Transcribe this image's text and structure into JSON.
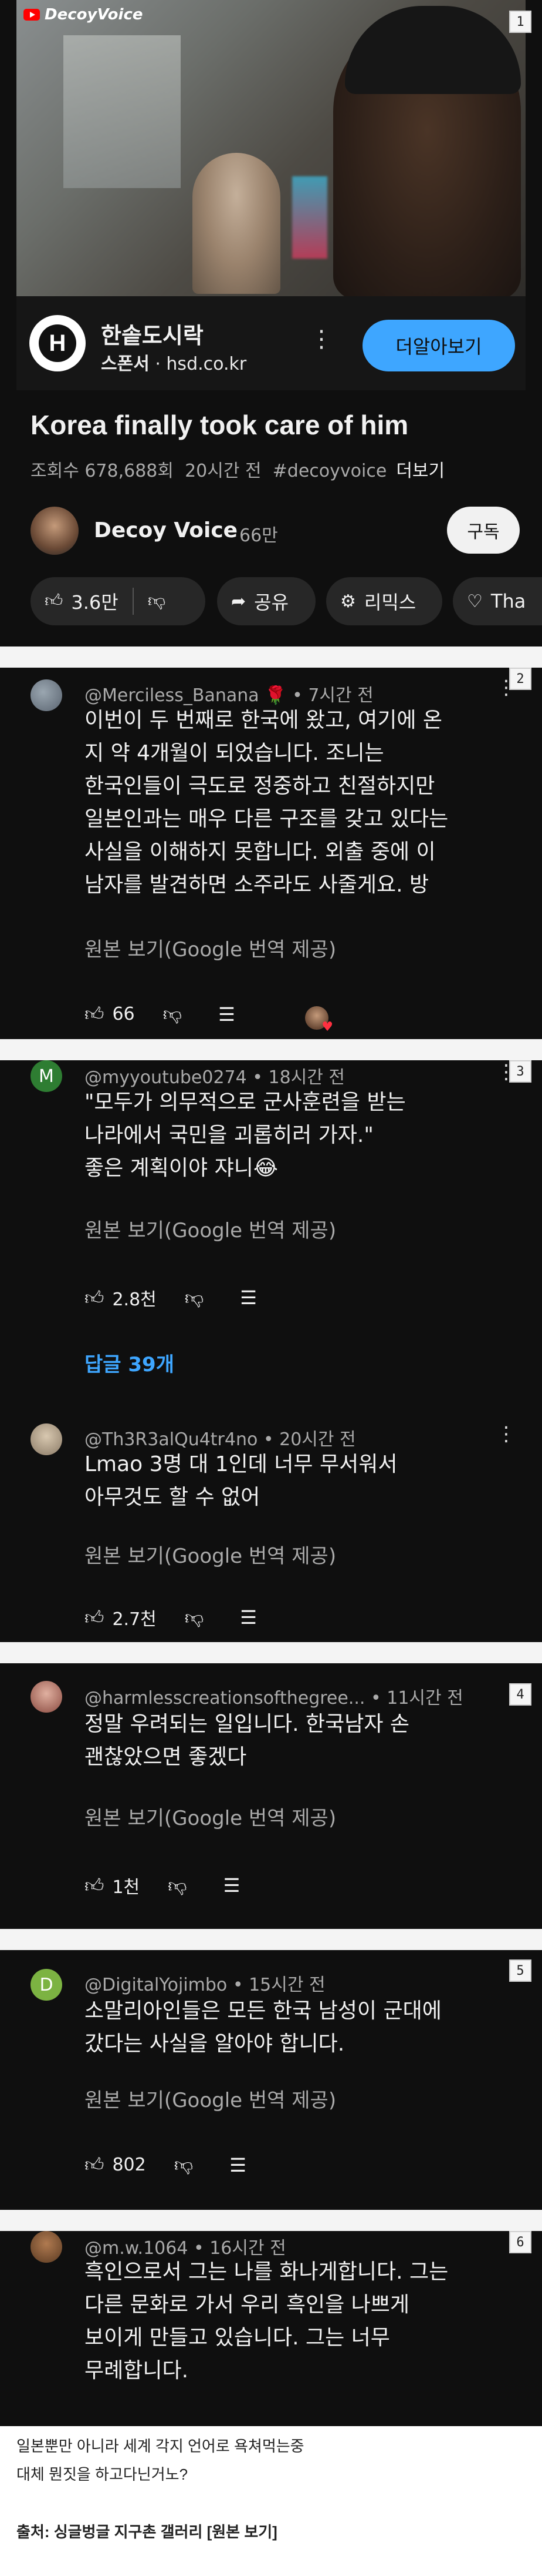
{
  "video": {
    "brand": "DecoyVoice"
  },
  "ad": {
    "name": "한솥도시락",
    "sponsor_label": "스폰서",
    "sponsor_domain": "hsd.co.kr",
    "cta": "더알아보기"
  },
  "title": "Korea finally took care of him",
  "meta": {
    "views": "조회수 678,688회",
    "time": "20시간 전",
    "hashtag": "#decoyvoice",
    "more": "더보기"
  },
  "channel": {
    "name": "Decoy Voice",
    "subs": "66만",
    "subscribe": "구독"
  },
  "actions": {
    "likes": "3.6만",
    "share": "공유",
    "remix": "리믹스",
    "thanks": "Tha"
  },
  "panel_numbers": [
    "1",
    "2",
    "3",
    "4",
    "5",
    "6"
  ],
  "comments": [
    {
      "author": "@Merciless_Banana",
      "time": "7시간 전",
      "lines": [
        "이번이 두 번째로 한국에 왔고, 여기에 온",
        "지 약 4개월이 되었습니다. 조니는",
        "한국인들이 극도로 정중하고 친절하지만",
        "일본인과는 매우 다른 구조를 갖고 있다는",
        "사실을 이해하지 못합니다. 외출 중에 이",
        "남자를 발견하면 소주라도 사줄게요. 방"
      ],
      "translate": "원본 보기(Google 번역 제공)",
      "likes": "66"
    },
    {
      "author": "@myyoutube0274",
      "time": "18시간 전",
      "lines": [
        "\"모두가 의무적으로 군사훈련을 받는",
        "나라에서 국민을 괴롭히러 가자.\"",
        "좋은 계획이야 쟈니😂"
      ],
      "translate": "원본 보기(Google 번역 제공)",
      "likes": "2.8천",
      "replies": "답글 39개"
    },
    {
      "author": "@Th3R3alQu4tr4no",
      "time": "20시간 전",
      "lines": [
        "Lmao 3명 대 1인데 너무 무서워서",
        "아무것도 할 수 없어"
      ],
      "translate": "원본 보기(Google 번역 제공)",
      "likes": "2.7천"
    },
    {
      "author": "@harmlesscreationsofthegree...",
      "time": "11시간 전",
      "lines": [
        "정말 우려되는 일입니다. 한국남자 손",
        "괜찮았으면 좋겠다"
      ],
      "translate": "원본 보기(Google 번역 제공)",
      "likes": "1천"
    },
    {
      "author": "@DigitalYojimbo",
      "time": "15시간 전",
      "lines": [
        "소말리아인들은 모든 한국 남성이 군대에",
        "갔다는 사실을 알아야 합니다."
      ],
      "translate": "원본 보기(Google 번역 제공)",
      "likes": "802"
    },
    {
      "author": "@m.w.1064",
      "time": "16시간 전",
      "lines": [
        "흑인으로서 그는 나를 화나게합니다. 그는",
        "다른 문화로 가서 우리 흑인을 나쁘게",
        "보이게 만들고 있습니다. 그는 너무",
        "무례합니다."
      ]
    }
  ],
  "captions": [
    "일본뿐만 아니라 세계 각지 언어로 욕쳐먹는중",
    "대체 뭔짓을 하고다닌거노?"
  ],
  "source": "출처: 싱글벙글 지구촌 갤러리 [원본 보기]"
}
